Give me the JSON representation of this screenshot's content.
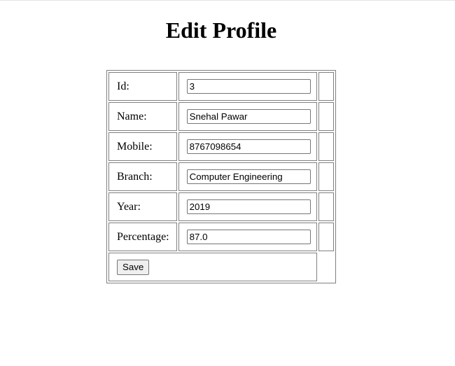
{
  "page": {
    "heading": "Edit Profile"
  },
  "form": {
    "fields": [
      {
        "label": "Id:",
        "value": "3"
      },
      {
        "label": "Name:",
        "value": "Snehal Pawar"
      },
      {
        "label": "Mobile:",
        "value": "8767098654"
      },
      {
        "label": "Branch:",
        "value": "Computer Engineering"
      },
      {
        "label": "Year:",
        "value": "2019"
      },
      {
        "label": "Percentage:",
        "value": "87.0"
      }
    ],
    "save_label": "Save"
  }
}
